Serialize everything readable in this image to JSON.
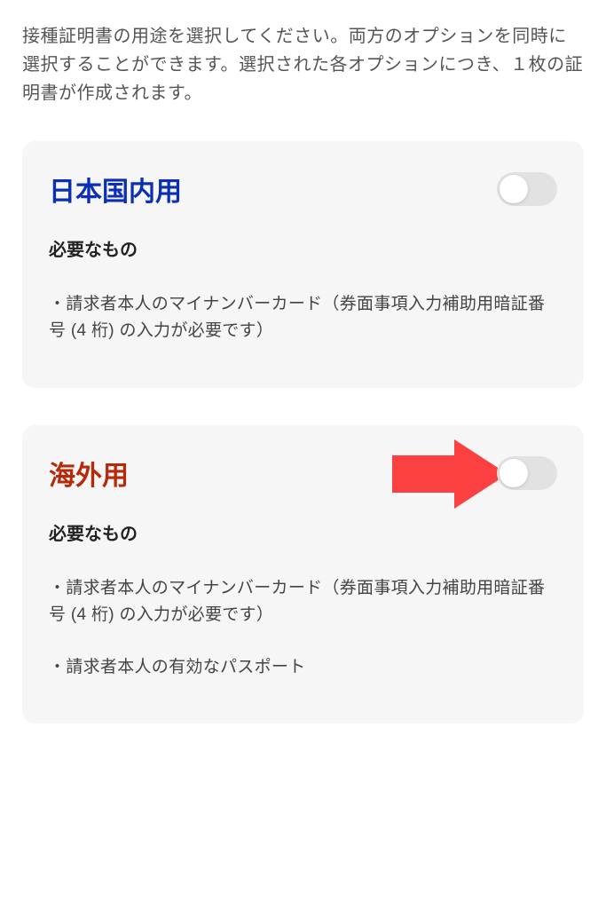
{
  "intro": "接種証明書の用途を選択してください。両方のオプションを同時に選択することができます。選択された各オプションにつき、１枚の証明書が作成されます。",
  "cards": [
    {
      "title": "日本国内用",
      "subhead": "必要なもの",
      "requirements": [
        "・請求者本人のマイナンバーカード（券面事項入力補助用暗証番号 (4 桁) の入力が必要です）"
      ],
      "toggle_on": false
    },
    {
      "title": "海外用",
      "subhead": "必要なもの",
      "requirements": [
        "・請求者本人のマイナンバーカード（券面事項入力補助用暗証番号 (4 桁) の入力が必要です）",
        "・請求者本人の有効なパスポート"
      ],
      "toggle_on": false
    }
  ]
}
